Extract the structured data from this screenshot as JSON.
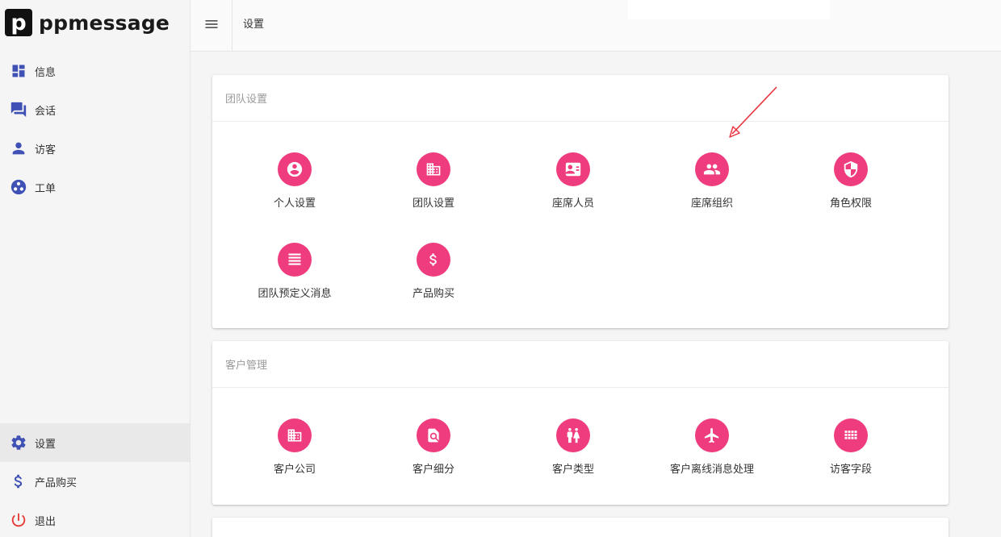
{
  "brand": {
    "mark": "p",
    "name": "ppmessage"
  },
  "sidebar": {
    "items": [
      {
        "label": "信息",
        "icon": "dashboard-icon"
      },
      {
        "label": "会话",
        "icon": "forum-icon"
      },
      {
        "label": "访客",
        "icon": "person-icon"
      },
      {
        "label": "工单",
        "icon": "workspaces-icon"
      }
    ],
    "bottom_items": [
      {
        "label": "设置",
        "icon": "gear-icon",
        "active": true
      },
      {
        "label": "产品购买",
        "icon": "dollar-icon"
      },
      {
        "label": "退出",
        "icon": "power-icon"
      }
    ]
  },
  "topbar": {
    "title": "设置",
    "menu_icon": "hamburger-icon"
  },
  "sections": [
    {
      "title": "团队设置",
      "items": [
        {
          "label": "个人设置",
          "icon": "account-circle-icon"
        },
        {
          "label": "团队设置",
          "icon": "business-icon"
        },
        {
          "label": "座席人员",
          "icon": "contact-card-icon"
        },
        {
          "label": "座席组织",
          "icon": "people-icon"
        },
        {
          "label": "角色权限",
          "icon": "shield-icon"
        },
        {
          "label": "团队预定义消息",
          "icon": "list-icon"
        },
        {
          "label": "产品购买",
          "icon": "dollar-icon"
        }
      ]
    },
    {
      "title": "客户管理",
      "items": [
        {
          "label": "客户公司",
          "icon": "business-icon"
        },
        {
          "label": "客户细分",
          "icon": "find-in-page-icon"
        },
        {
          "label": "客户类型",
          "icon": "wc-icon"
        },
        {
          "label": "客户离线消息处理",
          "icon": "airplane-icon"
        },
        {
          "label": "访客字段",
          "icon": "grid-icon"
        }
      ]
    }
  ],
  "colors": {
    "accent": "#ef3c7f",
    "nav_icon": "#3f51b5",
    "exit_icon": "#e53935",
    "annotation_arrow": "#e8323c"
  }
}
